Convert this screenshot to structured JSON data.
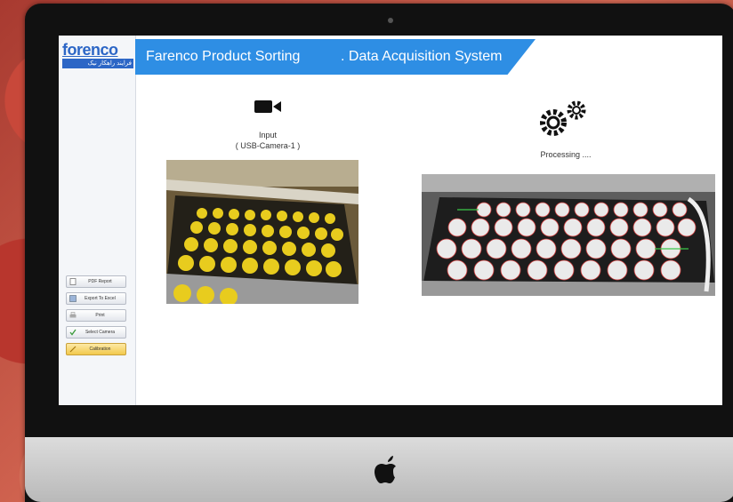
{
  "app": {
    "logo_text": "forenco",
    "logo_subtitle": "فرایند راهکار نیک",
    "title_left": "Farenco Product Sorting",
    "title_right": ". Data Acquisition System"
  },
  "sidebar": {
    "buttons": [
      {
        "label": "PDF Report",
        "icon": "document-icon"
      },
      {
        "label": "Export To Excel",
        "icon": "excel-icon"
      },
      {
        "label": "Print",
        "icon": "printer-icon"
      },
      {
        "label": "Select Camera",
        "icon": "check-icon"
      },
      {
        "label": "Calibration",
        "icon": "calibration-icon"
      }
    ]
  },
  "input_panel": {
    "title": "Input",
    "source": "( USB-Camera-1 )",
    "icon": "video-camera-icon"
  },
  "output_panel": {
    "status": "Processing ....",
    "icon": "gears-icon"
  },
  "colors": {
    "title_bar": "#2e8ee4",
    "logo_blue": "#2c66c6",
    "active_button": "#f2c94c"
  }
}
